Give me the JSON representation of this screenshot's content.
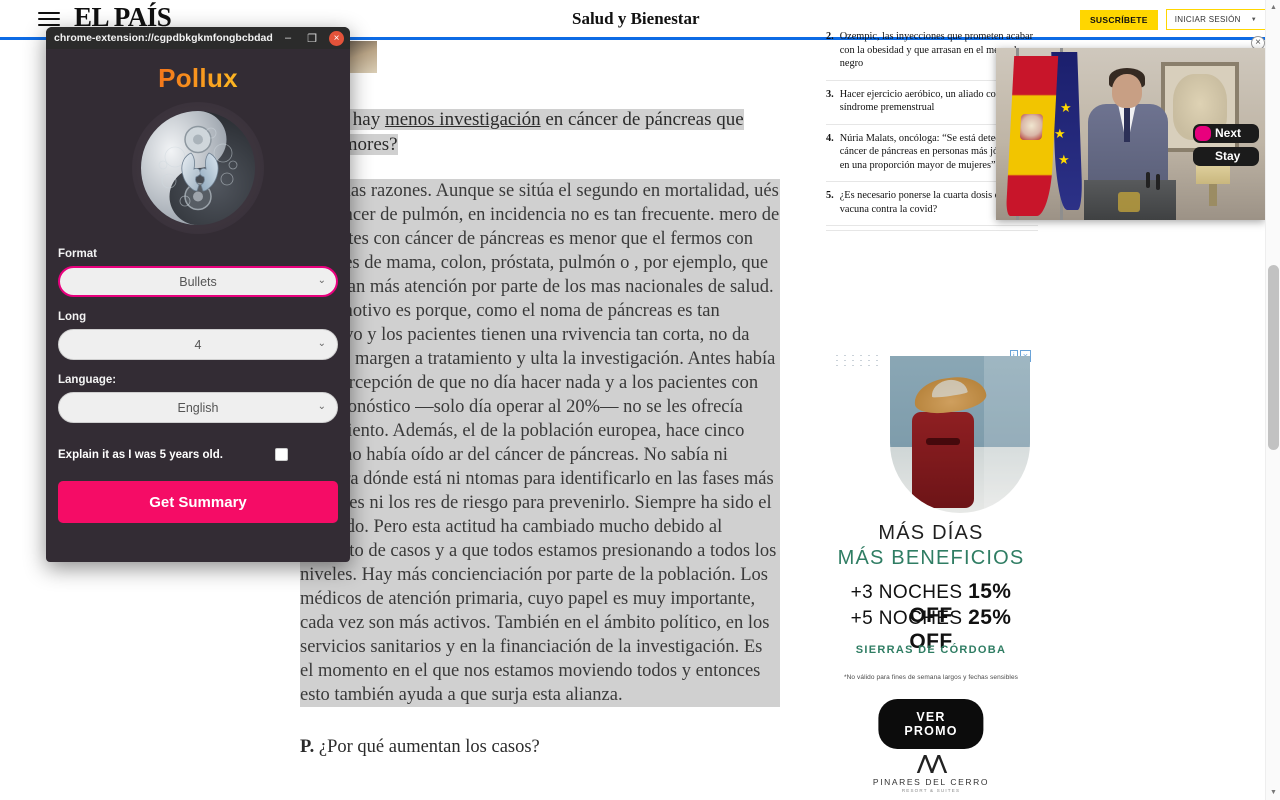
{
  "site": {
    "masthead": "EL PAÍS",
    "section": "Salud y Bienestar",
    "subscribe_label": "SUSCRÍBETE",
    "login_label": "INICIAR SESIÓN",
    "login_caret": "▼",
    "menu_icon": "hamburger-menu-icon"
  },
  "article": {
    "question_prefix": "¿",
    "question_line_1": "or qué hay ",
    "question_link": "menos investigación",
    "question_line_1b": " en cáncer de páncreas que",
    "question_line_2": "ros tumores?",
    "body": "ay varias razones. Aunque se sitúa el segundo en mortalidad, ués del cáncer de pulmón, en incidencia no es tan frecuente. mero de pacientes con cáncer de páncreas es menor que el fermos con tumores de mama, colon, próstata, pulmón o , por ejemplo, que se llevan más atención por parte de los mas nacionales de salud. Otro motivo es porque, como el noma de páncreas es tan agresivo y los pacientes tienen una rvivencia tan corta, no da mucho margen a tratamiento y ulta la investigación. Antes había una percepción de que no día hacer nada y a los pacientes con mal pronóstico —solo día operar al 20%— no se les ofrecía tratamiento. Además, el de la población europea, hace cinco años, no había oído ar del cáncer de páncreas. No sabía ni siquiera dónde está ni ntomas para identificarlo en las fases más precoces ni los res de riesgo para prevenirlo. Siempre ha sido el gran ado. Pero esta actitud ha cambiado mucho debido al aumento de casos y a que todos estamos presionando a todos los niveles. Hay más concienciación por parte de la población. Los médicos de atención primaria, cuyo papel es muy importante, cada vez son más activos. También en el ámbito político, en los servicios sanitarios y en la financiación de la investigación. Es el momento en el que nos estamos moviendo todos y entonces esto también ayuda a que surja esta alianza.",
    "next_question_marker": "P.",
    "next_question": "¿Por qué aumentan los casos?"
  },
  "most_read": [
    {
      "num": "2.",
      "text": "Ozempic, las inyecciones que prometen acabar con la obesidad y que arrasan en el mercado negro"
    },
    {
      "num": "3.",
      "text": "Hacer ejercicio aeróbico, un aliado contra el síndrome premenstrual"
    },
    {
      "num": "4.",
      "text": "Núria Malats, oncóloga: “Se está detectando cáncer de páncreas en personas más jóvenes y en una proporción mayor de mujeres”"
    },
    {
      "num": "5.",
      "text": "¿Es necesario ponerse la cuarta dosis de la vacuna contra la covid?"
    }
  ],
  "video": {
    "next_label": "Next",
    "stay_label": "Stay",
    "close_icon": "×"
  },
  "ad": {
    "headline_1": "MÁS DÍAS",
    "headline_2": "MÁS BENEFICIOS",
    "offer_1_pre": "+3 NOCHES ",
    "offer_1_bold": "15% OFF",
    "offer_2_pre": "+5 NOCHES ",
    "offer_2_bold": "25% OFF",
    "location": "SIERRAS DE CÓRDOBA",
    "disclaimer": "*No válido para fines de semana largos y fechas sensibles",
    "cta_label": "VER PROMO",
    "brand_mark": "⋀⋀",
    "brand_name": "PINARES DEL CERRO",
    "brand_sub": "RESORT & SUITES",
    "adchoices_info": "i",
    "adchoices_close": "×"
  },
  "popup": {
    "window_url": "chrome-extension://cgpdbkgkmfongbcbdaddfg...",
    "minimize_icon": "–",
    "maximize_icon": "❐",
    "close_icon": "×",
    "brand": "Pollux",
    "logo_icon": "yin-yang-two-faces-logo",
    "format_label": "Format",
    "format_value": "Bullets",
    "long_label": "Long",
    "long_value": "4",
    "language_label": "Language:",
    "language_value": "English",
    "explain_label": "Explain it as I was 5 years old.",
    "explain_checked": false,
    "submit_label": "Get Summary",
    "accent_color": "#e8007d",
    "button_color": "#f50c66",
    "caret_icon": "⌄"
  },
  "scrollbar": {
    "up_icon": "▲",
    "down_icon": "▼"
  }
}
